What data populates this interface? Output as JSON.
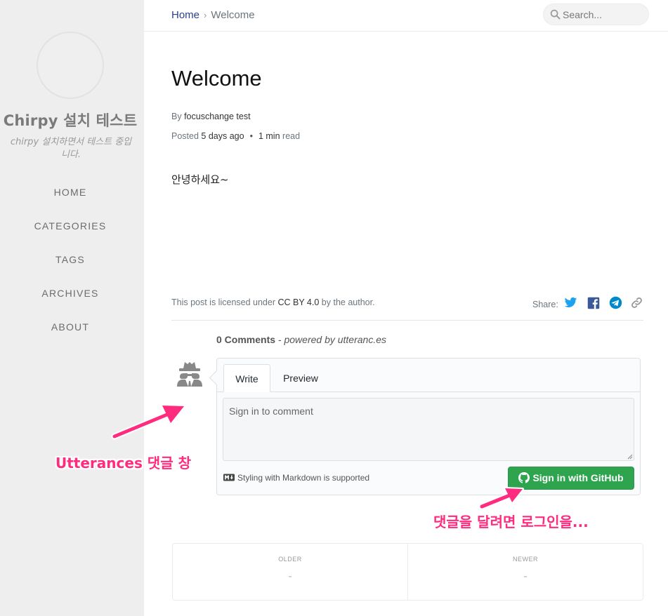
{
  "sidebar": {
    "site_title": "Chirpy 설치 테스트",
    "site_subtitle": "chirpy 설치하면서 테스트 중입니다.",
    "nav": [
      {
        "label": "HOME"
      },
      {
        "label": "CATEGORIES"
      },
      {
        "label": "TAGS"
      },
      {
        "label": "ARCHIVES"
      },
      {
        "label": "ABOUT"
      }
    ]
  },
  "topbar": {
    "breadcrumb_home": "Home",
    "breadcrumb_separator": "›",
    "breadcrumb_current": "Welcome",
    "search_placeholder": "Search..."
  },
  "post": {
    "title": "Welcome",
    "by_prefix": "By",
    "author": "focuschange test",
    "posted_prefix": "Posted",
    "posted_ago": "5 days ago",
    "read_time_value": "1 min",
    "read_time_suffix": "read",
    "body": "안녕하세요~",
    "license_prefix": "This post is licensed under",
    "license_name": "CC BY 4.0",
    "license_suffix": "by the author.",
    "share_label": "Share:"
  },
  "share_icons": [
    "twitter-icon",
    "facebook-icon",
    "telegram-icon",
    "link-icon"
  ],
  "colors": {
    "twitter": "#1da1f2",
    "facebook": "#3b5998",
    "telegram": "#0088cc",
    "link": "#999999",
    "github_button": "#2ea44f",
    "annotation": "#ff2b7e",
    "breadcrumb_link": "#2a408e"
  },
  "comments": {
    "count_label": "0 Comments",
    "powered_by": "- powered by utteranc.es",
    "tab_write": "Write",
    "tab_preview": "Preview",
    "textarea_placeholder": "Sign in to comment",
    "markdown_hint": "Styling with Markdown is supported",
    "signin_button": "Sign in with GitHub"
  },
  "annotations": {
    "utterances_label": "Utterances 댓글 창",
    "login_hint": "댓글을 달려면 로그인을..."
  },
  "post_nav": {
    "older_label": "OLDER",
    "older_value": "-",
    "newer_label": "NEWER",
    "newer_value": "-"
  }
}
